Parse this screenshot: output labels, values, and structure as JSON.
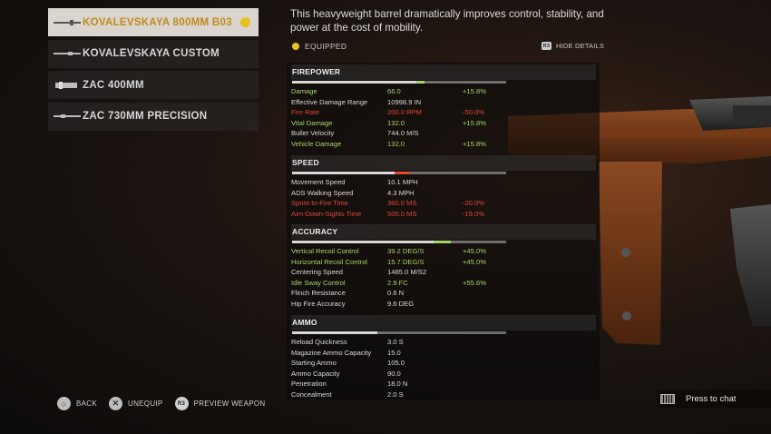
{
  "barrels": [
    {
      "label": "KOVALEVSKAYA 800MM B03",
      "selected": true
    },
    {
      "label": "KOVALEVSKAYA CUSTOM",
      "selected": false
    },
    {
      "label": "ZAC 400MM",
      "selected": false
    },
    {
      "label": "ZAC 730MM PRECISION",
      "selected": false
    }
  ],
  "description": "This heavyweight barrel dramatically improves control, stability, and power at the cost of mobility.",
  "equipped_label": "EQUIPPED",
  "hide_details": {
    "key": "R3",
    "label": "HIDE DETAILS"
  },
  "colors": {
    "positive": "#a7d36b",
    "negative": "#e0463a",
    "selected_text": "#c08a1a",
    "equipped_dot": "#e7c21f"
  },
  "sections": [
    {
      "title": "FIREPOWER",
      "bar": {
        "base": 0.58,
        "mod": 0.04,
        "mod_color": "#a7d36b"
      },
      "rows": [
        {
          "name": "Damage",
          "value": "66.0",
          "delta": "+15.8%",
          "tone": "pos"
        },
        {
          "name": "Effective Damage Range",
          "value": "10998.9 IN",
          "delta": "",
          "tone": ""
        },
        {
          "name": "Fire Rate",
          "value": "200.0 RPM",
          "delta": "-50.0%",
          "tone": "neg"
        },
        {
          "name": "Vital Damage",
          "value": "132.0",
          "delta": "+15.8%",
          "tone": "pos"
        },
        {
          "name": "Bullet Velocity",
          "value": "744.0 M/S",
          "delta": "",
          "tone": ""
        },
        {
          "name": "Vehicle Damage",
          "value": "132.0",
          "delta": "+15.8%",
          "tone": "pos"
        }
      ]
    },
    {
      "title": "SPEED",
      "bar": {
        "base": 0.48,
        "mod": 0.07,
        "mod_color": "#e0463a"
      },
      "rows": [
        {
          "name": "Movement Speed",
          "value": "10.1 MPH",
          "delta": "",
          "tone": ""
        },
        {
          "name": "ADS Walking Speed",
          "value": "4.3 MPH",
          "delta": "",
          "tone": ""
        },
        {
          "name": "Sprint-to-Fire Time",
          "value": "360.0 MS",
          "delta": "-20.0%",
          "tone": "neg"
        },
        {
          "name": "Aim-Down-Sights Time",
          "value": "500.0 MS",
          "delta": "-19.0%",
          "tone": "neg"
        }
      ]
    },
    {
      "title": "ACCURACY",
      "bar": {
        "base": 0.66,
        "mod": 0.08,
        "mod_color": "#a7d36b"
      },
      "rows": [
        {
          "name": "Vertical Recoil Control",
          "value": "39.2 DEG/S",
          "delta": "+45.0%",
          "tone": "pos"
        },
        {
          "name": "Horizontal Recoil Control",
          "value": "15.7 DEG/S",
          "delta": "+45.0%",
          "tone": "pos"
        },
        {
          "name": "Centering Speed",
          "value": "1485.0 M/S2",
          "delta": "",
          "tone": ""
        },
        {
          "name": "Idle Sway Control",
          "value": "2.9 FC",
          "delta": "+55.6%",
          "tone": "pos"
        },
        {
          "name": "Flinch Resistance",
          "value": "0.6 N",
          "delta": "",
          "tone": ""
        },
        {
          "name": "Hip Fire Accuracy",
          "value": "9.6 DEG",
          "delta": "",
          "tone": ""
        }
      ]
    },
    {
      "title": "AMMO",
      "bar": {
        "base": 0.4,
        "mod": 0,
        "mod_color": "#a7d36b"
      },
      "rows": [
        {
          "name": "Reload Quickness",
          "value": "3.0 S",
          "delta": "",
          "tone": ""
        },
        {
          "name": "Magazine Ammo Capacity",
          "value": "15.0",
          "delta": "",
          "tone": ""
        },
        {
          "name": "Starting Ammo",
          "value": "105.0",
          "delta": "",
          "tone": ""
        },
        {
          "name": "Ammo Capacity",
          "value": "90.0",
          "delta": "",
          "tone": ""
        },
        {
          "name": "Penetration",
          "value": "18.0 N",
          "delta": "",
          "tone": ""
        },
        {
          "name": "Concealment",
          "value": "2.0 S",
          "delta": "",
          "tone": ""
        }
      ]
    }
  ],
  "controls": [
    {
      "label": "BACK",
      "icon": "circle-button-icon"
    },
    {
      "label": "UNEQUIP",
      "icon": "cross-button-icon"
    },
    {
      "label": "PREVIEW WEAPON",
      "icon": "r3-button-icon",
      "key": "R3"
    }
  ],
  "chat": {
    "label": "Press to chat",
    "icon": "keyboard-icon"
  }
}
